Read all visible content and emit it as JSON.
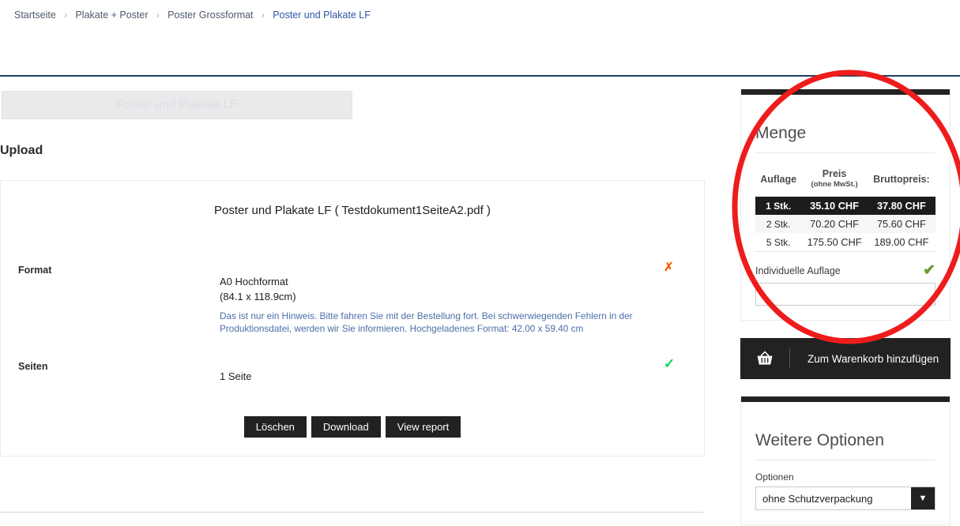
{
  "breadcrumb": {
    "separator": "›",
    "items": [
      {
        "label": "Startseite"
      },
      {
        "label": "Plakate + Poster"
      },
      {
        "label": "Poster Grossformat"
      },
      {
        "label": "Poster und Plakate LF"
      }
    ]
  },
  "main": {
    "title_box_text": "Poster und Plakate LF",
    "upload_heading": "Upload",
    "document_title": "Poster und Plakate LF ( Testdokument1SeiteA2.pdf )",
    "rows": {
      "format_label": "Format",
      "format_value_line1": "A0 Hochformat",
      "format_value_line2": "(84.1 x 118.9cm)",
      "format_hint": "Das ist nur ein Hinweis. Bitte fahren Sie mit der Bestellung fort. Bei schwerwiegenden Fehlern in der Produktionsdatei, werden wir Sie informieren. Hochgeladenes Format: 42.00 x 59.40 cm",
      "format_status_icon": "cross-icon",
      "format_status_glyph": "✗",
      "seiten_label": "Seiten",
      "seiten_value": "1 Seite",
      "seiten_status_icon": "check-icon",
      "seiten_status_glyph": "✓"
    },
    "buttons": {
      "delete": "Löschen",
      "download": "Download",
      "view_report": "View report"
    }
  },
  "sidebar": {
    "quantity_panel": {
      "heading": "Menge",
      "table": {
        "headers": {
          "auflage": "Auflage",
          "preis": "Preis",
          "preis_sub": "(ohne MwSt.)",
          "brutto": "Bruttopreis:"
        },
        "rows": [
          {
            "auflage": "1 Stk.",
            "preis": "35.10 CHF",
            "brutto": "37.80 CHF",
            "selected": true
          },
          {
            "auflage": "2 Stk.",
            "preis": "70.20 CHF",
            "brutto": "75.60 CHF",
            "selected": false
          },
          {
            "auflage": "5 Stk.",
            "preis": "175.50 CHF",
            "brutto": "189.00 CHF",
            "selected": false
          }
        ]
      },
      "individual_label": "Individuelle Auflage",
      "individual_value": "",
      "individual_placeholder": "",
      "status_glyph": "✔"
    },
    "cart_button": {
      "label": "Zum Warenkorb hinzufügen",
      "icon": "shopping-basket-icon"
    },
    "options_panel": {
      "heading": "Weitere Optionen",
      "option_label": "Optionen",
      "selected_option": "ohne Schutzverpackung",
      "arrow_glyph": "▼"
    }
  },
  "annotation": {
    "type": "ellipse-highlight",
    "color": "#ee1c1c"
  },
  "colors": {
    "accent_dark": "#222222",
    "breadcrumb_active": "#2f55a4",
    "hint_blue": "#4a6fa8",
    "error_orange": "#f4610a",
    "ok_green": "#0ad65f",
    "check_olive": "#6d9b33",
    "annotation_red": "#ee1c1c",
    "rule_navy": "#1f3f63"
  }
}
